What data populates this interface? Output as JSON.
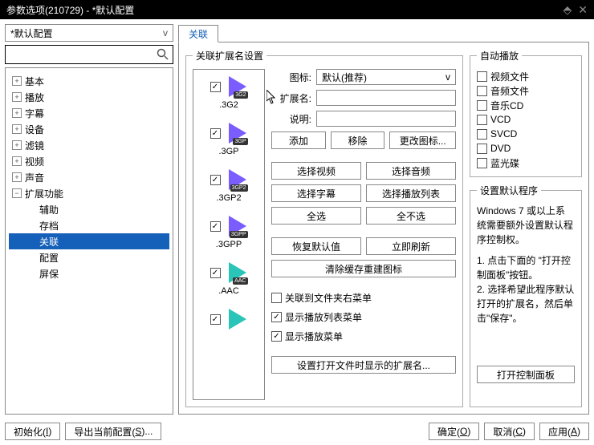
{
  "title": "参数选项(210729) - *默认配置",
  "config_selected": "*默认配置",
  "tree": [
    {
      "label": "基本",
      "toggle": "+"
    },
    {
      "label": "播放",
      "toggle": "+"
    },
    {
      "label": "字幕",
      "toggle": "+"
    },
    {
      "label": "设备",
      "toggle": "+"
    },
    {
      "label": "滤镜",
      "toggle": "+"
    },
    {
      "label": "视频",
      "toggle": "+"
    },
    {
      "label": "声音",
      "toggle": "+"
    },
    {
      "label": "扩展功能",
      "toggle": "−"
    },
    {
      "label": "辅助",
      "indent": true
    },
    {
      "label": "存档",
      "indent": true
    },
    {
      "label": "关联",
      "indent": true,
      "selected": true
    },
    {
      "label": "配置",
      "indent": true
    },
    {
      "label": "屏保",
      "indent": true
    }
  ],
  "tab_label": "关联",
  "ext_fieldset_legend": "关联扩展名设置",
  "extensions": [
    {
      "badge": "3G2",
      "label": ".3G2"
    },
    {
      "badge": "3GP",
      "label": ".3GP"
    },
    {
      "badge": "3GP2",
      "label": ".3GP2"
    },
    {
      "badge": "3GPP",
      "label": ".3GPP"
    },
    {
      "badge": "AAC",
      "label": ".AAC",
      "teal": true
    }
  ],
  "form": {
    "icon_label": "图标:",
    "icon_value": "默认(推荐)",
    "ext_label": "扩展名:",
    "desc_label": "说明:"
  },
  "buttons": {
    "add": "添加",
    "remove": "移除",
    "change_icon": "更改图标...",
    "select_video": "选择视频",
    "select_audio": "选择音频",
    "select_subtitle": "选择字幕",
    "select_playlist": "选择播放列表",
    "select_all": "全选",
    "select_none": "全不选",
    "restore_default": "恢复默认值",
    "refresh": "立即刷新",
    "clear_cache": "清除缓存重建图标",
    "set_ext_display": "设置打开文件时显示的扩展名..."
  },
  "checkboxes": {
    "context_menu": "关联到文件夹右菜单",
    "show_playlist_menu": "显示播放列表菜单",
    "show_play_menu": "显示播放菜单"
  },
  "autoplay": {
    "legend": "自动播放",
    "items": [
      "视频文件",
      "音频文件",
      "音乐CD",
      "VCD",
      "SVCD",
      "DVD",
      "蓝光碟"
    ]
  },
  "defprog": {
    "legend": "设置默认程序",
    "text1": "Windows 7 或以上系统需要额外设置默认程序控制权。",
    "text2": "1. 点击下面的 \"打开控制面板\"按钮。",
    "text3": "2. 选择希望此程序默认打开的扩展名，然后单击\"保存\"。",
    "open_cp": "打开控制面板"
  },
  "bottom": {
    "init": "初始化(",
    "init_u": "I",
    "init_e": ")",
    "export": "导出当前配置(",
    "export_u": "S",
    "export_e": ")...",
    "ok": "确定(",
    "ok_u": "O",
    "ok_e": ")",
    "cancel": "取消(",
    "cancel_u": "C",
    "cancel_e": ")",
    "apply": "应用(",
    "apply_u": "A",
    "apply_e": ")"
  }
}
